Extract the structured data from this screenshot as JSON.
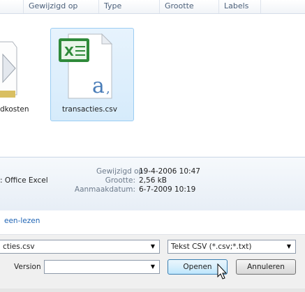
{
  "columns": [
    "Gewijzigd op",
    "Type",
    "Grootte",
    "Labels"
  ],
  "files": [
    {
      "label": "dkosten"
    },
    {
      "label": "transacties.csv",
      "selected": true
    }
  ],
  "details": {
    "type_value": ": Office Excel",
    "modified_label": "Gewijzigd op:",
    "modified_value": "19-4-2006 10:47",
    "size_label": "Grootte:",
    "size_value": "2,56 kB",
    "created_label": "Aanmaakdatum:",
    "created_value": "6-7-2009 10:19"
  },
  "link_text": "een-lezen",
  "filename_value": "cties.csv",
  "filter_value": "Tekst CSV (*.csv;*.txt)",
  "version_label": "Version",
  "version_value": "",
  "buttons": {
    "open": "Openen",
    "cancel": "Annuleren"
  },
  "colors": {
    "accent": "#9bcdf3",
    "link": "#1f64b4",
    "excel_green": "#2f8a3a"
  },
  "icons": [
    "folder-document-icon",
    "excel-csv-file-icon",
    "dropdown-arrow-icon",
    "mouse-cursor-icon"
  ]
}
